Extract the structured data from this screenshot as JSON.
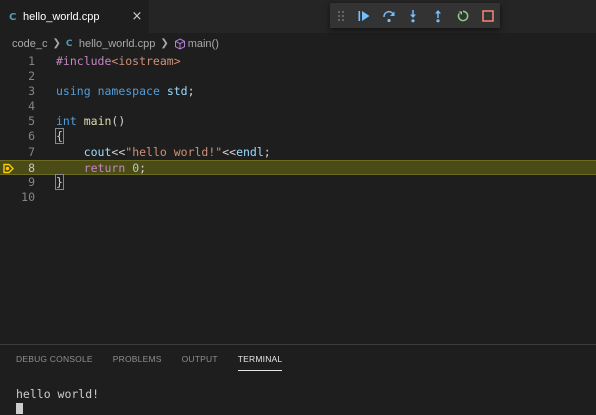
{
  "tab": {
    "label": "hello_world.cpp",
    "icon": "C",
    "close": "×"
  },
  "breadcrumb": {
    "folder": "code_c",
    "file": "hello_world.cpp",
    "symbol": "main()",
    "file_icon": "C"
  },
  "debug_toolbar": {
    "buttons": [
      "continue",
      "step-over",
      "step-into",
      "step-out",
      "restart",
      "stop"
    ]
  },
  "editor": {
    "lines": [
      {
        "num": "1",
        "tokens": [
          {
            "t": "#include",
            "c": "pp"
          },
          {
            "t": "<iostream>",
            "c": "str"
          }
        ]
      },
      {
        "num": "2",
        "tokens": []
      },
      {
        "num": "3",
        "tokens": [
          {
            "t": "using",
            "c": "kw"
          },
          {
            "t": " ",
            "c": "plain"
          },
          {
            "t": "namespace",
            "c": "kw"
          },
          {
            "t": " ",
            "c": "plain"
          },
          {
            "t": "std",
            "c": "id"
          },
          {
            "t": ";",
            "c": "plain"
          }
        ]
      },
      {
        "num": "4",
        "tokens": []
      },
      {
        "num": "5",
        "tokens": [
          {
            "t": "int",
            "c": "kw"
          },
          {
            "t": " ",
            "c": "plain"
          },
          {
            "t": "main",
            "c": "fn"
          },
          {
            "t": "()",
            "c": "plain"
          }
        ]
      },
      {
        "num": "6",
        "tokens": [
          {
            "t": "{",
            "c": "plain",
            "box": true
          }
        ]
      },
      {
        "num": "7",
        "tokens": [
          {
            "t": "    ",
            "c": "plain"
          },
          {
            "t": "cout",
            "c": "id"
          },
          {
            "t": "<<",
            "c": "plain"
          },
          {
            "t": "\"hello world!\"",
            "c": "str"
          },
          {
            "t": "<<",
            "c": "plain"
          },
          {
            "t": "endl",
            "c": "id"
          },
          {
            "t": ";",
            "c": "plain"
          }
        ]
      },
      {
        "num": "8",
        "tokens": [
          {
            "t": "    ",
            "c": "plain"
          },
          {
            "t": "return",
            "c": "pp"
          },
          {
            "t": " ",
            "c": "plain"
          },
          {
            "t": "0",
            "c": "num"
          },
          {
            "t": ";",
            "c": "plain"
          }
        ],
        "current": true
      },
      {
        "num": "9",
        "tokens": [
          {
            "t": "}",
            "c": "plain",
            "box": true
          }
        ]
      },
      {
        "num": "10",
        "tokens": []
      }
    ]
  },
  "panel": {
    "tabs": [
      {
        "label": "DEBUG CONSOLE",
        "active": false
      },
      {
        "label": "PROBLEMS",
        "active": false
      },
      {
        "label": "OUTPUT",
        "active": false
      },
      {
        "label": "TERMINAL",
        "active": true
      }
    ],
    "terminal_output": "hello world!"
  },
  "colors": {
    "background": "#1e1e1e",
    "current_line": "#4b4b18",
    "debug_icon": "#75beff",
    "stop_icon": "#f48771",
    "restart_icon": "#89d185",
    "breakpoint_arrow": "#ffcc00"
  }
}
